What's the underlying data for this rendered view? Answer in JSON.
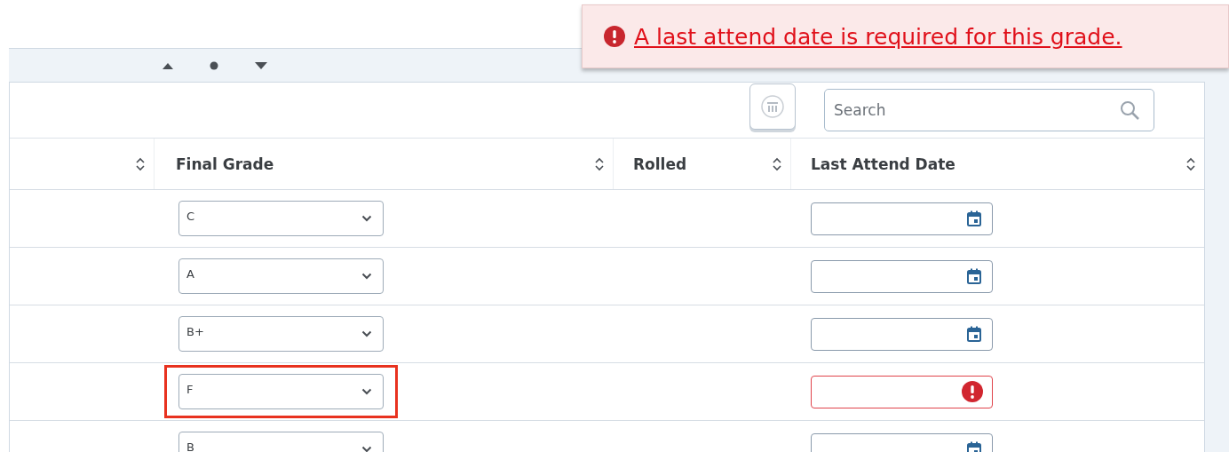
{
  "toast": {
    "message": "A last attend date is required for this grade."
  },
  "search": {
    "placeholder": "Search"
  },
  "columns": [
    "Final Grade",
    "Rolled",
    "Last Attend Date"
  ],
  "rows": [
    {
      "grade": "C",
      "highlighted": false,
      "date_error": false
    },
    {
      "grade": "A",
      "highlighted": false,
      "date_error": false
    },
    {
      "grade": "B+",
      "highlighted": false,
      "date_error": false
    },
    {
      "grade": "F",
      "highlighted": true,
      "date_error": true
    },
    {
      "grade": "B",
      "highlighted": false,
      "date_error": false
    }
  ]
}
